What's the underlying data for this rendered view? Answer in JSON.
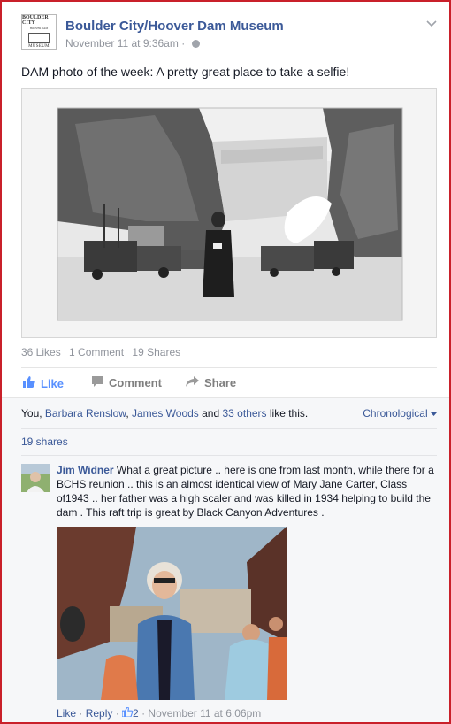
{
  "post": {
    "page_name": "Boulder City/Hoover Dam Museum",
    "logo": {
      "line1": "BOULDER CITY",
      "line2": "HOOVER DAM",
      "line3": "MUSEUM"
    },
    "timestamp": "November 11 at 9:36am",
    "separator": " · ",
    "text": "DAM photo of the week: A pretty great place to take a selfie!"
  },
  "stats": {
    "likes": "36 Likes",
    "comments": "1 Comment",
    "shares": "19 Shares"
  },
  "actions": {
    "like": "Like",
    "comment": "Comment",
    "share": "Share"
  },
  "feedback": {
    "likes_prefix": "You, ",
    "liker1": "Barbara Renslow",
    "sep": ", ",
    "liker2": "James Woods",
    "and": " and ",
    "others": "33 others",
    "likes_suffix": " like this.",
    "sort": "Chronological",
    "shares_link": "19 shares"
  },
  "comment": {
    "author": "Jim Widner",
    "text": " What a great picture .. here is one from last month, while there for a BCHS reunion .. this is an almost identical view of Mary Jane Carter, Class of1943 .. her father was a high scaler and was killed in 1934 helping to build the dam . This raft trip is great by Black Canyon Adventures .",
    "like": "Like",
    "dot1": " · ",
    "reply": "Reply",
    "dot2": " · ",
    "reaction_count": "2",
    "dot3": " · ",
    "time": "November 11 at 6:06pm"
  },
  "colors": {
    "link": "#3b5998",
    "like_blue": "#5890ff",
    "meta_gray": "#90949c",
    "frame_red": "#c9202a"
  }
}
